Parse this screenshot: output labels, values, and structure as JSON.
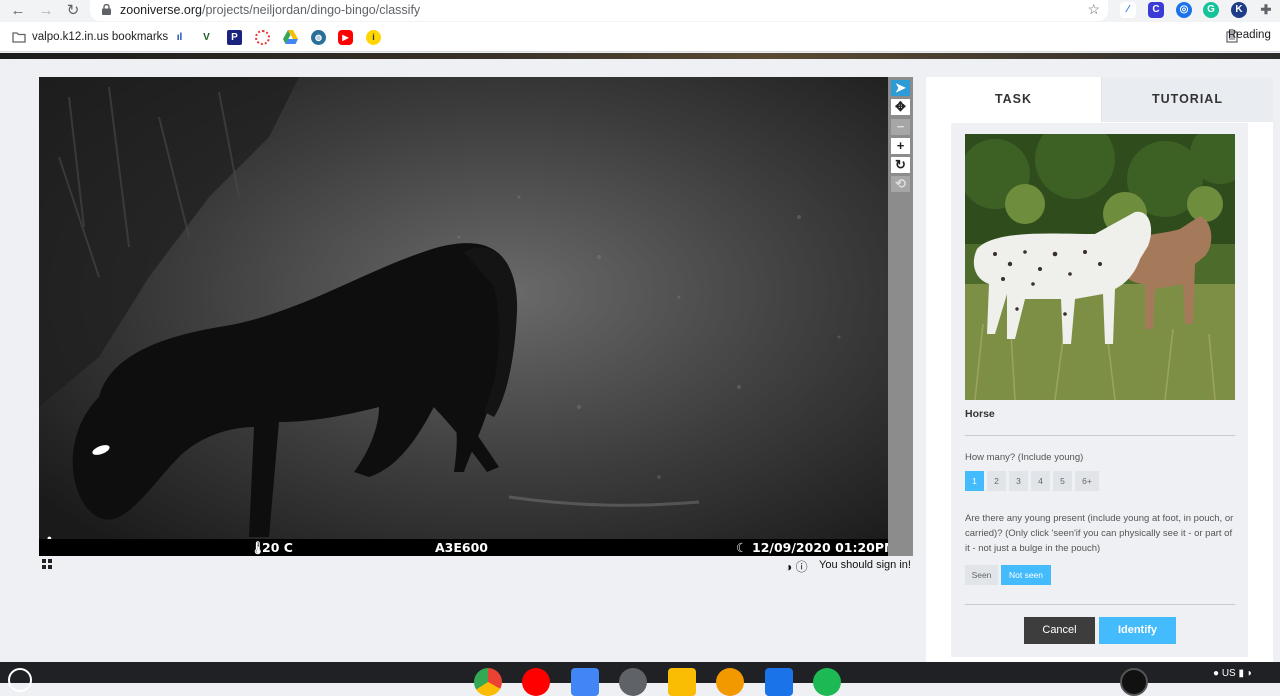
{
  "browser": {
    "url_host": "zooniverse.org",
    "url_path": "/projects/neiljordan/dingo-bingo/classify",
    "bookmarks_folder": "valpo.k12.in.us bookmarks",
    "reading_list": "Reading"
  },
  "subject": {
    "temperature": "20 C",
    "camera_id": "A3E600",
    "timestamp": "12/09/2020 01:20PM",
    "signin_prompt": "You should sign in!"
  },
  "tools": {
    "pointer": "pointer-icon",
    "pan": "move-icon",
    "zoom_out": "minus-icon",
    "zoom_in": "plus-icon",
    "rotate": "rotate-icon",
    "reset": "reset-icon"
  },
  "panel": {
    "tab_task": "TASK",
    "tab_tutorial": "TUTORIAL",
    "animal": "Horse",
    "how_many_question": "How many? (Include young)",
    "how_many_options": [
      "1",
      "2",
      "3",
      "4",
      "5",
      "6+"
    ],
    "how_many_selected": "1",
    "young_question": "Are there any young present (include young at foot, in pouch, or carried)? (Only click 'seen'if you can physically see it - or part of it - not just a bulge in the pouch)",
    "young_options": [
      "Seen",
      "Not seen"
    ],
    "young_selected": "Not seen",
    "cancel_label": "Cancel",
    "identify_label": "Identify"
  },
  "colors": {
    "accent": "#43bbfd",
    "tool_active": "#2d9bd6",
    "cancel": "#3d3d3d"
  }
}
